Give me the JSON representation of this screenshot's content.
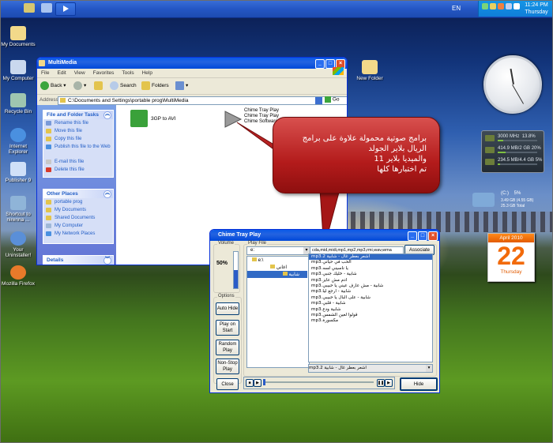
{
  "taskbar": {
    "lang": "EN",
    "time": "11:24 PM",
    "day": "Thursday"
  },
  "desktop_icons": [
    {
      "label": "My Documents"
    },
    {
      "label": "My Computer"
    },
    {
      "label": "Recycle Bin"
    },
    {
      "label": "Internet Explorer"
    },
    {
      "label": "Publisher 9"
    },
    {
      "label": "Shortcut to nirenna ..."
    },
    {
      "label": "Your Uninstaller!"
    },
    {
      "label": "Mozilla Firefox"
    }
  ],
  "new_folder": {
    "label": "New Folder"
  },
  "cpu_gadget": {
    "cpu": "3000 MHz",
    "cpu_pct": "13.8%",
    "ram": "414.9 MB/2 GB",
    "ram_pct": "20%",
    "swap": "234.5 MB/4.4 GB",
    "swap_pct": "5%"
  },
  "net_gadget": {
    "label": "(C:)",
    "pct": "5%",
    "line1": "3.49 GB (4.55 GB)",
    "line2": "25.3 GB Total"
  },
  "calendar": {
    "month": "April 2010",
    "day": "22",
    "weekday": "Thursday"
  },
  "explorer": {
    "title": "MultiMedia",
    "menu": [
      "File",
      "Edit",
      "View",
      "Favorites",
      "Tools",
      "Help"
    ],
    "toolbar": {
      "back": "Back",
      "search": "Search",
      "folders": "Folders"
    },
    "address_label": "Address",
    "address": "C:\\Documents and Settings\\portable prog\\MultiMedia",
    "go": "Go",
    "tasks_title": "File and Folder Tasks",
    "tasks": [
      "Rename this file",
      "Move this file",
      "Copy this file",
      "Publish this file to the Web",
      "E-mail this file",
      "Delete this file"
    ],
    "places_title": "Other Places",
    "places": [
      "portable prog",
      "My Documents",
      "Shared Documents",
      "My Computer",
      "My Network Places"
    ],
    "details_title": "Details",
    "files": [
      {
        "name": "3GP to AVI"
      },
      {
        "name": "Chime Tray Play",
        "desc1": "Chime Tray Play",
        "desc2": "Chime Software"
      }
    ]
  },
  "bubble": {
    "line1": "برامج صوتية محمولة علاوة على برامج",
    "line2": "الريال بلاير الجولد",
    "line3": "والميديا بلاير 11",
    "line4": "تم اختبارها كلها"
  },
  "chime": {
    "title": "Chime Tray Play",
    "volume_label": "Volume",
    "volume_value": "50%",
    "options_label": "Options",
    "play_file_label": "Play File",
    "drive": "e:",
    "types": "cda,mid,midi,mp1,mp2,mp3,rmi,wav,wma",
    "associate": "Associate",
    "folders": [
      "e:\\",
      "اغاني",
      "شابية"
    ],
    "songs": [
      "اشعر بعطر غال - شابية 2.mp3",
      "الحب في حياتي.mp3",
      "يا ناسيني لسه.mp3",
      "شابية - خليك جنبي.mp3",
      "ادم مش عايز.mp3",
      "شابية - مش عارف عيني يا حبيبي.mp3",
      "شابية - ارجع ليا.mp3",
      "شابية - على البال يا حبيبي.mp3",
      "شابية - قلبي.mp3",
      "شابية ودع.mp3",
      "قولوا لعين الشمس.mp3",
      "مكسورة.mp3"
    ],
    "buttons": {
      "auto_hide": "Auto Hide",
      "play_on_start": "Play on Start",
      "random_play": "Random Play",
      "nonstop_play": "Non-Stop Play",
      "close": "Close",
      "hide": "Hide"
    },
    "now_playing": "اشعر بعطر غال - شابية 2.mp3"
  }
}
